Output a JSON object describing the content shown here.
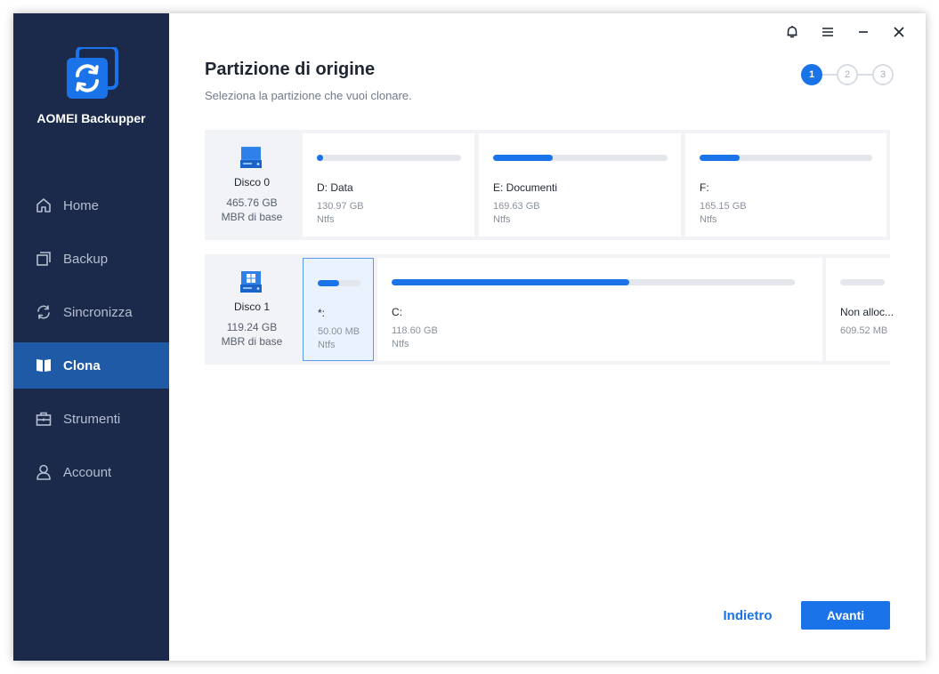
{
  "app": {
    "name": "AOMEI Backupper",
    "brand_color": "#1a73e8",
    "sidebar_color": "#1b2a4a",
    "active_nav_color": "#1f5aa6"
  },
  "titlebar": {
    "icons": [
      "bell-icon",
      "menu-icon",
      "minimize-icon",
      "close-icon"
    ]
  },
  "sidebar": {
    "items": [
      {
        "label": "Home",
        "icon": "home-icon",
        "active": false
      },
      {
        "label": "Backup",
        "icon": "backup-icon",
        "active": false
      },
      {
        "label": "Sincronizza",
        "icon": "sync-icon",
        "active": false
      },
      {
        "label": "Clona",
        "icon": "clone-icon",
        "active": true
      },
      {
        "label": "Strumenti",
        "icon": "tools-icon",
        "active": false
      },
      {
        "label": "Account",
        "icon": "user-icon",
        "active": false
      }
    ]
  },
  "header": {
    "title": "Partizione di origine",
    "subtitle": "Seleziona la partizione che vuoi clonare."
  },
  "steps": {
    "items": [
      "1",
      "2",
      "3"
    ],
    "current": 1
  },
  "disks": [
    {
      "name": "Disco 0",
      "size": "465.76 GB",
      "type": "MBR di base",
      "icon": "hard-disk-icon",
      "partitions": [
        {
          "label": "D: Data",
          "size": "130.97 GB",
          "fs": "Ntfs",
          "used_fraction": 0.03,
          "selected": false
        },
        {
          "label": "E: Documenti",
          "size": "169.63 GB",
          "fs": "Ntfs",
          "used_fraction": 0.34,
          "selected": false
        },
        {
          "label": "F:",
          "size": "165.15 GB",
          "fs": "Ntfs",
          "used_fraction": 0.23,
          "selected": false
        }
      ]
    },
    {
      "name": "Disco 1",
      "size": "119.24 GB",
      "type": "MBR di base",
      "icon": "system-disk-icon",
      "partitions": [
        {
          "label": "*:",
          "size": "50.00 MB",
          "fs": "Ntfs",
          "used_fraction": 0.5,
          "selected": true
        },
        {
          "label": "C:",
          "size": "118.60 GB",
          "fs": "Ntfs",
          "used_fraction": 0.59,
          "selected": false
        },
        {
          "label": "Non alloc...",
          "size": "609.52 MB",
          "fs": "",
          "used_fraction": 0,
          "selected": false
        }
      ]
    }
  ],
  "footer": {
    "back_label": "Indietro",
    "next_label": "Avanti"
  }
}
